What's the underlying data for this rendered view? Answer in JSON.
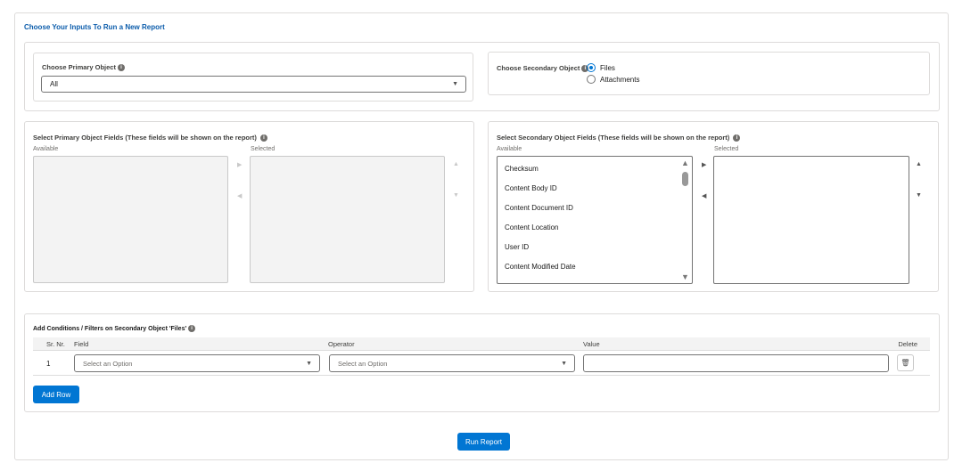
{
  "title": "Choose Your Inputs To Run a New Report",
  "primary_object": {
    "label": "Choose Primary Object",
    "value": "All"
  },
  "secondary_object": {
    "label": "Choose Secondary Object",
    "options": [
      {
        "label": "Files",
        "selected": true
      },
      {
        "label": "Attachments",
        "selected": false
      }
    ]
  },
  "primary_fields": {
    "heading": "Select Primary Object Fields (These fields will be shown on the report)",
    "available_label": "Available",
    "selected_label": "Selected",
    "available": [],
    "selected": []
  },
  "secondary_fields": {
    "heading": "Select Secondary Object Fields (These fields will be shown on the report)",
    "available_label": "Available",
    "selected_label": "Selected",
    "available": [
      "Checksum",
      "Content Body ID",
      "Content Document ID",
      "Content Location",
      "User ID",
      "Content Modified Date"
    ],
    "selected": []
  },
  "conditions": {
    "heading": "Add Conditions / Filters on Secondary Object 'Files'",
    "columns": [
      "Sr. Nr.",
      "Field",
      "Operator",
      "Value",
      "Delete"
    ],
    "rows": [
      {
        "nr": "1",
        "field_placeholder": "Select an Option",
        "operator_placeholder": "Select an Option",
        "value": ""
      }
    ],
    "add_row_label": "Add Row"
  },
  "run_report_label": "Run Report",
  "colors": {
    "accent": "#0176d3",
    "title": "#0b5cab"
  }
}
